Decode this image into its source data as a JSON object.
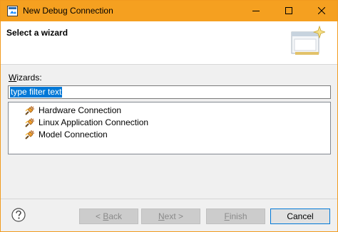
{
  "window": {
    "title": "New Debug Connection"
  },
  "banner": {
    "title": "Select a wizard"
  },
  "wizards": {
    "label_mnemonic": "W",
    "label_rest": "izards:",
    "filter_value": "type filter text"
  },
  "tree": {
    "items": [
      {
        "label": "Hardware Connection",
        "icon": "connection-icon"
      },
      {
        "label": "Linux Application Connection",
        "icon": "connection-icon"
      },
      {
        "label": "Model Connection",
        "icon": "connection-icon"
      }
    ]
  },
  "buttons": {
    "back_prefix": "< ",
    "back_mnemonic": "B",
    "back_rest": "ack",
    "next_mnemonic": "N",
    "next_rest": "ext >",
    "finish_mnemonic": "F",
    "finish_rest": "inish",
    "cancel": "Cancel"
  },
  "colors": {
    "titlebar": "#f5a020",
    "selection": "#0078d7"
  }
}
